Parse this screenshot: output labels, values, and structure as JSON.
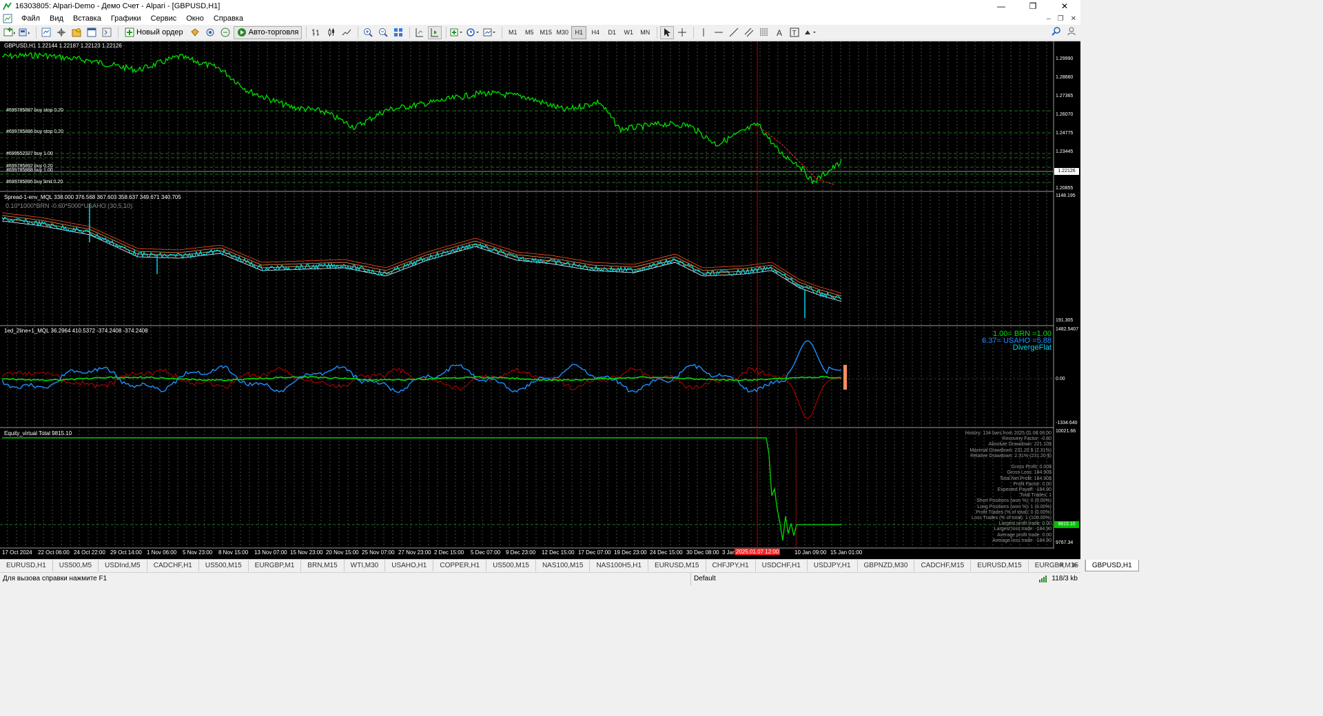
{
  "window": {
    "title": "16303805: Alpari-Demo - Демо Счет - Alpari - [GBPUSD,H1]"
  },
  "menu": [
    "Файл",
    "Вид",
    "Вставка",
    "Графики",
    "Сервис",
    "Окно",
    "Справка"
  ],
  "toolbar": {
    "new_order": "Новый ордер",
    "autotrading": "Авто-торговля",
    "timeframes": [
      "M1",
      "M5",
      "M15",
      "M30",
      "H1",
      "H4",
      "D1",
      "W1",
      "MN"
    ],
    "active_timeframe": "H1"
  },
  "chart": {
    "price_pane": {
      "header": "GBPUSD,H1  1.22144 1.22187 1.22123 1.22126",
      "price_labels": [
        "1.29990",
        "1.28660",
        "1.27365",
        "1.26070",
        "1.24775",
        "1.23445",
        "1.20855"
      ],
      "current_price": "1.22126",
      "orders": [
        "#699785887 buy stop 0.20",
        "#699785886 buy stop 0.20",
        "#699552327 buy 1.00",
        "#699785892 buy 0.20",
        "#699785888 buy 1.00",
        "#699785895 buy limit 0.20"
      ]
    },
    "spread_pane": {
      "header": "Spread-1-env_MQL 338.000 376.568 367.603 358.637 349.671 340.705",
      "formula": "0.10*1000*BRN -0.60*5000*USAHO (30,5,10)",
      "top_label": "1148.195",
      "bottom_label": "191.305"
    },
    "osc_pane": {
      "header": "1ed_2line+1_MQL 36.2964 410.5372 -374.2408 -374.2408",
      "top_label": "1482.5407",
      "zero_label": "0.00",
      "bottom_label": "-1334.640",
      "legend": {
        "line1": "1.00= BRN =1.00",
        "line2": "6.37= USAHO =5.88",
        "line3": "DivergeFlat"
      }
    },
    "equity_pane": {
      "header": "Equity_virtual Total 9815.10",
      "top_label": "10021.66",
      "current_label": "9815.10",
      "bottom_label": "9767.34",
      "stats": [
        "History: 134 bars from 2025.01.08 06:00",
        "Recovery Factor: -0.80",
        "Absolute Drawdown: 221.10$",
        "Maximal Drawdown: 231.20 $ (2.31%)",
        "Relative Drawdown: 2.31% (231.20 $)",
        "",
        "Gross Profit: 0.00$",
        "Gross Loss: 184.90$",
        "Total Net Profit: 184.90$",
        "Profit Factor: 0.00",
        "Expected Payoff: -184.90",
        "Total Trades: 1",
        "Short Positions (won %): 0 (0.00%)",
        "Long Positions (won %): 1 (0.00%)",
        "Profit Trades (% of total): 0 (0.00%)",
        "Loss Trades (% of total): 1 (100.00%)",
        "Largest profit trade: 0.00",
        "Largest loss trade: -184.90",
        "Average profit trade: 0.00",
        "Average loss trade: -184.90"
      ]
    },
    "dates": [
      "17 Oct 2024",
      "22 Oct 06:00",
      "24 Oct 22:00",
      "29 Oct 14:00",
      "1 Nov 06:00",
      "5 Nov 23:00",
      "8 Nov 15:00",
      "13 Nov 07:00",
      "15 Nov 23:00",
      "20 Nov 15:00",
      "25 Nov 07:00",
      "27 Nov 23:00",
      "2 Dec 15:00",
      "5 Dec 07:00",
      "9 Dec 23:00",
      "12 Dec 15:00",
      "17 Dec 07:00",
      "19 Dec 23:00",
      "24 Dec 15:00",
      "30 Dec 08:00",
      "3 Jan",
      "10 Jan 09:00",
      "15 Jan 01:00"
    ],
    "highlighted_date": "2025.01.07 12:00"
  },
  "tabs": [
    "EURUSD,H1",
    "US500,M5",
    "USDInd,M5",
    "CADCHF,H1",
    "US500,M15",
    "EURGBP,M1",
    "BRN,M15",
    "WTI,M30",
    "USAHO,H1",
    "COPPER,H1",
    "US500,M15",
    "NAS100,M15",
    "NAS100H5,H1",
    "EURUSD,M15",
    "CHFJPY,H1",
    "USDCHF,H1",
    "USDJPY,H1",
    "GBPNZD,M30",
    "CADCHF,M15",
    "EURUSD,M15",
    "EURGBP,M15",
    "GBPUSD,H1"
  ],
  "active_tab": "GBPUSD,H1",
  "status": {
    "hint": "Для вызова справки нажмите F1",
    "profile": "Default",
    "traffic": "118/3 kb"
  },
  "colors": {
    "price_line": "#00e000",
    "spread_cyan": "#00d8e8",
    "spread_env": "#ff8040",
    "osc_blue": "#1e90ff",
    "osc_red": "#c00000",
    "osc_green": "#00e000",
    "equity": "#00d000",
    "grid": "#7a7a7a"
  }
}
